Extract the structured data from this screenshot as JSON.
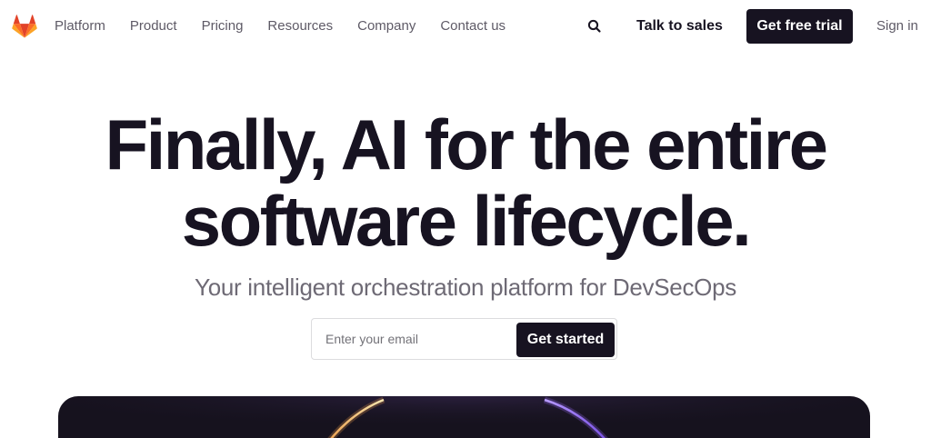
{
  "header": {
    "logo": "gitlab-tanuki-logo",
    "nav_items": [
      {
        "label": "Platform"
      },
      {
        "label": "Product"
      },
      {
        "label": "Pricing"
      },
      {
        "label": "Resources"
      },
      {
        "label": "Company"
      },
      {
        "label": "Contact us"
      }
    ],
    "search_icon": "search-icon",
    "talk_to_sales": "Talk to sales",
    "get_free_trial": "Get free trial",
    "sign_in": "Sign in"
  },
  "hero": {
    "title_line1": "Finally, AI for the entire",
    "title_line2": "software lifecycle.",
    "subtitle": "Your intelligent orchestration platform for DevSecOps",
    "email_placeholder": "Enter your email",
    "cta_label": "Get started"
  },
  "colors": {
    "primary_dark": "#171321",
    "text_muted": "#5e5a66",
    "logo_orange": "#fc6d26",
    "logo_dark_orange": "#e24329",
    "logo_light_orange": "#fca326"
  }
}
